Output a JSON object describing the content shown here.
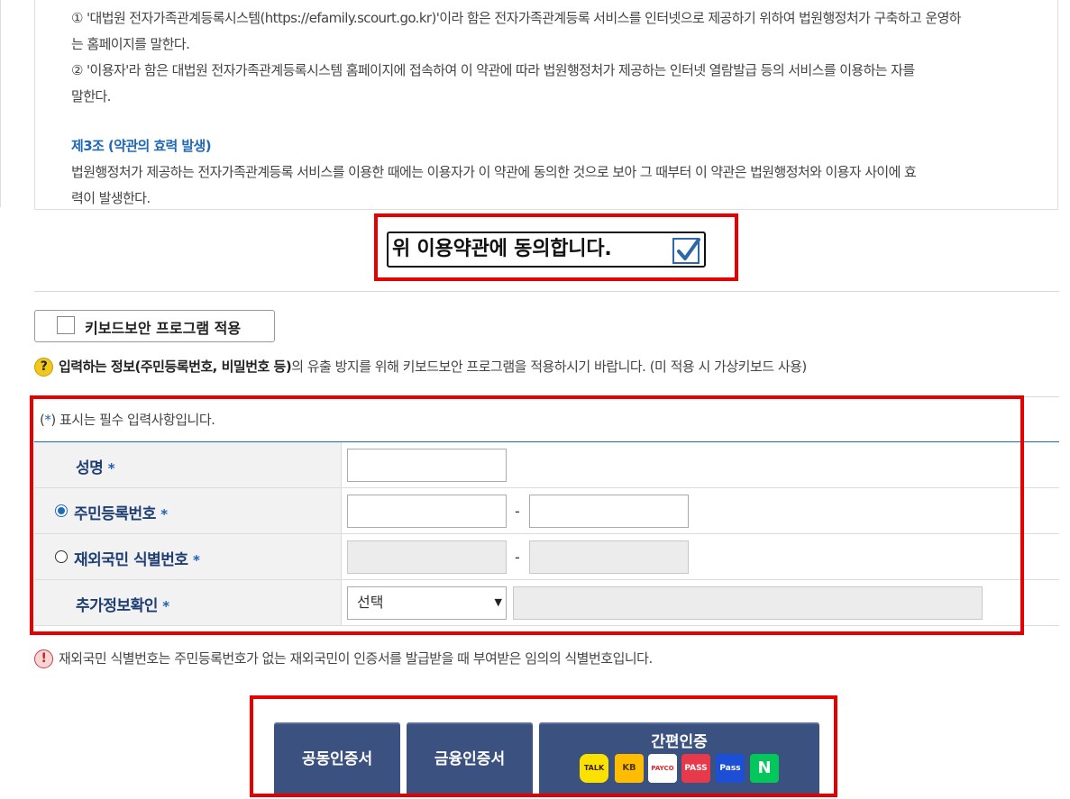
{
  "terms": {
    "lines": [
      "① '대법원 전자가족관계등록시스템(https://efamily.scourt.go.kr)'이라 함은 전자가족관계등록 서비스를 인터넷으로 제공하기 위하여 법원행정처가 구축하고 운영하",
      "는 홈페이지를 말한다.",
      "② '이용자'라 함은 대법원 전자가족관계등록시스템 홈페이지에 접속하여 이 약관에 따라 법원행정처가 제공하는 인터넷 열람발급 등의 서비스를 이용하는 자를",
      "말한다."
    ],
    "article_title": "제3조 (약관의 효력 발생)",
    "article_lines": [
      "법원행정처가 제공하는 전자가족관계등록 서비스를 이용한 때에는 이용자가 이 약관에 동의한 것으로 보아 그 때부터 이 약관은 법원행정처와 이용자 사이에 효",
      "력이 발생한다."
    ]
  },
  "agree": {
    "label": "위 이용약관에 동의합니다.",
    "checked": true
  },
  "keyboard_security": {
    "label": "키보드보안 프로그램 적용",
    "checked": false
  },
  "notice_keyboard": {
    "bold": "입력하는 정보(주민등록번호, 비밀번호 등)",
    "rest": "의 유출 방지를 위해 키보드보안 프로그램을 적용하시기 바랍니다. (미 적용 시 가상키보드 사용)"
  },
  "form": {
    "required_note": {
      "open": "(",
      "star": "*",
      "rest": ") 표시는 필수 입력사항입니다."
    },
    "rows": [
      {
        "label": "성명",
        "star": "*"
      },
      {
        "label": "주민등록번호",
        "star": "*",
        "radio_selected": true
      },
      {
        "label": "재외국민 식별번호",
        "star": "*",
        "radio_selected": false
      },
      {
        "label": "추가정보확인",
        "star": "*"
      }
    ],
    "dash": "-",
    "select_value": "선택",
    "select_arrow": "▼"
  },
  "notice_overseas": "재외국민 식별번호는 주민등록번호가 없는 재외국민이 인증서를 발급받을 때 부여받은 임의의 식별번호입니다.",
  "auth_buttons": {
    "joint_cert": "공동인증서",
    "financial_cert": "금융인증서",
    "simple_auth": "간편인증",
    "providers": [
      "TALK",
      "KB",
      "PAYCO",
      "PASS",
      "Pass",
      "N"
    ]
  },
  "icons": {
    "question": "?",
    "exclamation": "!"
  },
  "colors": {
    "highlight_red": "#e60000",
    "link_blue": "#1f69b6",
    "button_navy": "#3b5180",
    "label_navy": "#1e3e74"
  }
}
